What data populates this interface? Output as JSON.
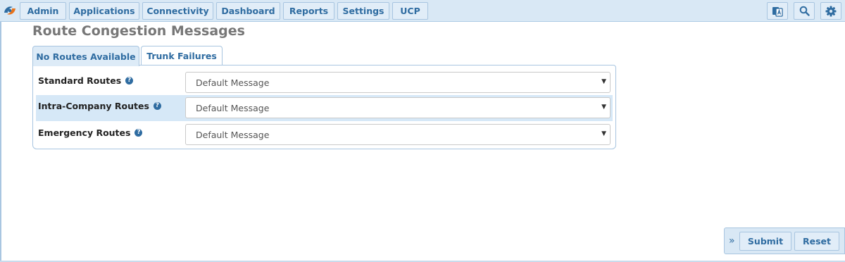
{
  "nav": {
    "items": [
      {
        "label": "Admin"
      },
      {
        "label": "Applications"
      },
      {
        "label": "Connectivity"
      },
      {
        "label": "Dashboard"
      },
      {
        "label": "Reports"
      },
      {
        "label": "Settings"
      },
      {
        "label": "UCP"
      }
    ],
    "icons": [
      "language-icon",
      "search-icon",
      "gear-icon"
    ]
  },
  "page": {
    "title": "Route Congestion Messages"
  },
  "tabs": [
    {
      "label": "No Routes Available",
      "active": true
    },
    {
      "label": "Trunk Failures",
      "active": false
    }
  ],
  "form": {
    "rows": [
      {
        "label": "Standard Routes",
        "value": "Default Message"
      },
      {
        "label": "Intra-Company Routes",
        "value": "Default Message"
      },
      {
        "label": "Emergency Routes",
        "value": "Default Message"
      }
    ]
  },
  "actions": {
    "collapse": "»",
    "submit": "Submit",
    "reset": "Reset"
  },
  "colors": {
    "accent": "#2f6ca1",
    "nav_background": "#d9e8f5",
    "row_highlight": "#d6e8f7",
    "title": "#777777"
  }
}
